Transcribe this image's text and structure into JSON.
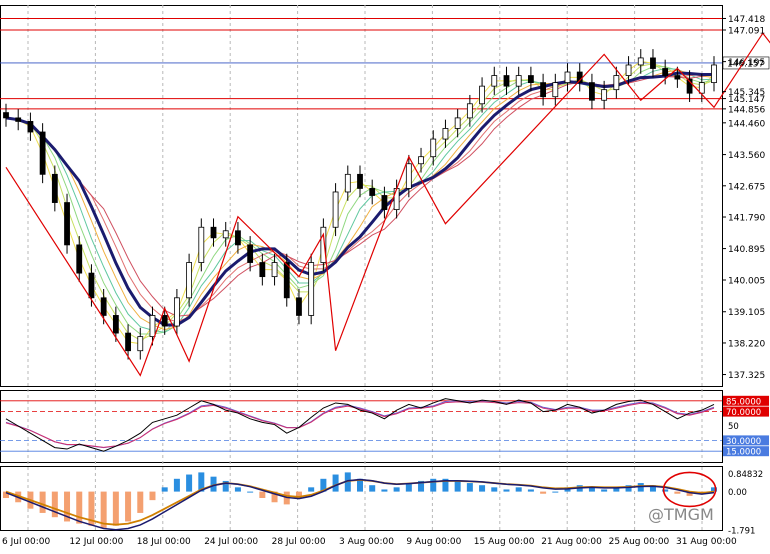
{
  "watermark": "@TMGM",
  "colors": {
    "background": "#ffffff",
    "grid": "#b8b8b8",
    "candle": "#000000",
    "trend": "#e00000",
    "level_line": "#e00000",
    "current_price": "#3050c0",
    "ma_main": "#1b1b6e",
    "macd_pos": "#2a8ee0",
    "macd_neg": "#f4a070",
    "signal": "#d08000",
    "stoch_k": "#000000",
    "stoch_d": "#d03070",
    "stoch_slow": "#6a5acd"
  },
  "chart_data": [
    {
      "type": "candlestick",
      "x_labels": [
        "6 Jul 00:00",
        "12 Jul 00:00",
        "18 Jul 00:00",
        "24 Jul 00:00",
        "28 Jul 00:00",
        "3 Aug 00:00",
        "9 Aug 00:00",
        "15 Aug 00:00",
        "21 Aug 00:00",
        "25 Aug 00:00",
        "31 Aug 00:00"
      ],
      "y_ticks": [
        "147.418",
        "147.091",
        "146.195",
        "145.345",
        "145.147",
        "144.856",
        "144.460",
        "143.560",
        "142.675",
        "141.790",
        "140.895",
        "140.005",
        "139.105",
        "138.220",
        "137.325"
      ],
      "ylim": [
        137.0,
        147.8
      ],
      "current_price": "146.157",
      "levels": [
        147.418,
        147.091,
        145.147,
        144.856
      ],
      "close": [
        144.6,
        144.5,
        144.2,
        143.0,
        142.2,
        141.0,
        140.2,
        139.5,
        139.0,
        138.5,
        138.0,
        138.4,
        139.0,
        138.7,
        139.5,
        140.5,
        141.5,
        141.2,
        141.4,
        141.0,
        140.5,
        140.1,
        140.5,
        139.5,
        139.0,
        140.5,
        141.5,
        142.5,
        143.0,
        142.6,
        142.4,
        142.0,
        142.6,
        143.3,
        143.5,
        144.0,
        144.3,
        144.6,
        145.0,
        145.5,
        145.8,
        145.5,
        145.8,
        145.6,
        145.2,
        145.6,
        145.9,
        145.6,
        145.1,
        145.4,
        145.8,
        146.1,
        146.3,
        146.0,
        145.8,
        145.7,
        145.3,
        145.6,
        146.1
      ],
      "trend_line": [
        [
          0,
          143.2
        ],
        [
          11,
          137.3
        ],
        [
          13,
          139.2
        ],
        [
          15,
          137.7
        ],
        [
          19,
          141.8
        ],
        [
          24,
          140.1
        ],
        [
          26,
          141.3
        ],
        [
          27,
          138.0
        ],
        [
          33,
          143.5
        ],
        [
          36,
          141.6
        ],
        [
          49,
          146.4
        ],
        [
          52,
          145.1
        ],
        [
          55,
          146.0
        ],
        [
          58,
          144.9
        ],
        [
          62,
          147.0
        ],
        [
          64,
          146.1
        ],
        [
          66,
          147.418
        ],
        [
          70,
          144.7
        ],
        [
          72,
          146.2
        ]
      ],
      "arrows": [
        {
          "from": [
            66,
            146.15
          ],
          "to": [
            74,
            146.15
          ]
        },
        {
          "from": [
            65,
            146.2
          ],
          "to": [
            70,
            144.7
          ]
        },
        {
          "from": [
            70,
            144.7
          ],
          "to": [
            72,
            146.2
          ]
        }
      ]
    },
    {
      "type": "line",
      "name": "stochastic",
      "ylim": [
        0,
        100
      ],
      "levels": [
        85,
        70,
        30,
        15
      ],
      "level_labels": [
        "85.0000",
        "70.0000",
        "30.0000",
        "15.0000"
      ],
      "mid_tick": "50",
      "k": [
        60,
        50,
        40,
        30,
        20,
        18,
        25,
        20,
        15,
        22,
        30,
        40,
        55,
        60,
        65,
        75,
        85,
        80,
        72,
        68,
        60,
        55,
        52,
        40,
        48,
        62,
        75,
        82,
        80,
        72,
        68,
        60,
        72,
        80,
        75,
        82,
        88,
        85,
        82,
        86,
        84,
        80,
        86,
        82,
        70,
        72,
        80,
        76,
        68,
        72,
        80,
        84,
        86,
        80,
        70,
        60,
        68,
        72,
        80
      ],
      "d": [
        55,
        50,
        44,
        36,
        28,
        24,
        24,
        22,
        20,
        22,
        26,
        34,
        46,
        54,
        60,
        68,
        78,
        80,
        76,
        70,
        64,
        58,
        54,
        48,
        48,
        56,
        68,
        76,
        79,
        75,
        70,
        64,
        68,
        75,
        76,
        78,
        84,
        85,
        84,
        85,
        84,
        82,
        84,
        83,
        76,
        73,
        76,
        76,
        72,
        72,
        76,
        80,
        83,
        82,
        76,
        68,
        66,
        70,
        76
      ]
    },
    {
      "type": "bar",
      "name": "macd",
      "ylim": [
        -1.8,
        1.2
      ],
      "y_ticks": [
        "0.84832",
        "0.00",
        "-1.791"
      ],
      "histogram": [
        -0.3,
        -0.5,
        -0.8,
        -1.0,
        -1.2,
        -1.4,
        -1.5,
        -1.6,
        -1.7,
        -1.6,
        -1.4,
        -1.0,
        -0.4,
        0.2,
        0.6,
        0.8,
        0.9,
        0.7,
        0.5,
        0.2,
        0.0,
        -0.3,
        -0.5,
        -0.6,
        -0.3,
        0.2,
        0.6,
        0.8,
        0.9,
        0.6,
        0.3,
        0.1,
        0.2,
        0.4,
        0.5,
        0.6,
        0.6,
        0.5,
        0.4,
        0.3,
        0.2,
        0.1,
        0.2,
        0.1,
        -0.1,
        0.0,
        0.2,
        0.3,
        0.2,
        0.1,
        0.2,
        0.3,
        0.4,
        0.3,
        0.1,
        -0.1,
        -0.2,
        -0.1,
        0.2
      ],
      "signal": [
        0.0,
        -0.2,
        -0.4,
        -0.6,
        -0.8,
        -1.0,
        -1.2,
        -1.35,
        -1.5,
        -1.55,
        -1.5,
        -1.35,
        -1.1,
        -0.8,
        -0.5,
        -0.2,
        0.1,
        0.3,
        0.4,
        0.35,
        0.25,
        0.1,
        -0.05,
        -0.2,
        -0.25,
        -0.15,
        0.05,
        0.3,
        0.5,
        0.55,
        0.5,
        0.4,
        0.35,
        0.38,
        0.42,
        0.46,
        0.5,
        0.5,
        0.48,
        0.45,
        0.4,
        0.35,
        0.32,
        0.28,
        0.2,
        0.15,
        0.16,
        0.2,
        0.22,
        0.2,
        0.2,
        0.22,
        0.26,
        0.27,
        0.22,
        0.12,
        0.0,
        -0.06,
        0.0
      ]
    }
  ]
}
